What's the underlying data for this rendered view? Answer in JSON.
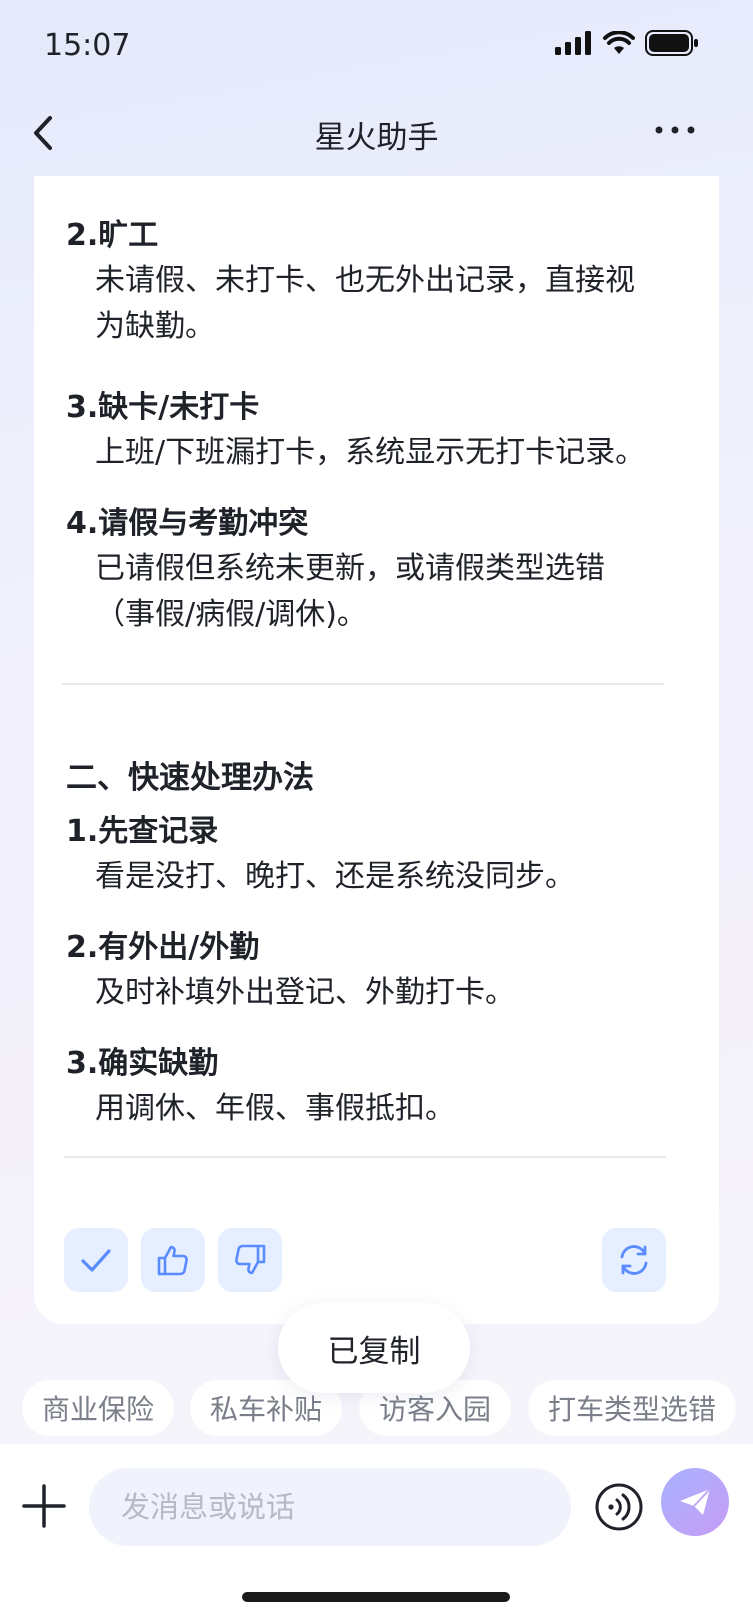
{
  "status_bar": {
    "time": "15:07"
  },
  "nav": {
    "title": "星火助手"
  },
  "content": {
    "items_top": [
      {
        "heading": "2.旷工",
        "lines": [
          "未请假、未打卡、也无外出记录，直接视",
          "为缺勤。"
        ]
      },
      {
        "heading": "3.缺卡/未打卡",
        "lines": [
          "上班/下班漏打卡，系统显示无打卡记录。"
        ]
      },
      {
        "heading": "4.请假与考勤冲突",
        "lines": [
          "已请假但系统未更新，或请假类型选错",
          "（事假/病假/调休)。"
        ]
      }
    ],
    "section_title": "二、快速处理办法",
    "items_bottom": [
      {
        "heading": "1.先查记录",
        "lines": [
          "看是没打、晚打、还是系统没同步。"
        ]
      },
      {
        "heading": "2.有外出/外勤",
        "lines": [
          "及时补填外出登记、外勤打卡。"
        ]
      },
      {
        "heading": "3.确实缺勤",
        "lines": [
          "用调休、年假、事假抵扣。"
        ]
      }
    ]
  },
  "toast": {
    "text": "已复制"
  },
  "suggestions": [
    "商业保险",
    "私车补贴",
    "访客入园",
    "打车类型选错"
  ],
  "input": {
    "placeholder": "发消息或说话"
  },
  "colors": {
    "accent": "#5b8cff",
    "action_bg": "#e6efff",
    "send_gradient": [
      "#a9b2ff",
      "#c69cf5"
    ]
  }
}
